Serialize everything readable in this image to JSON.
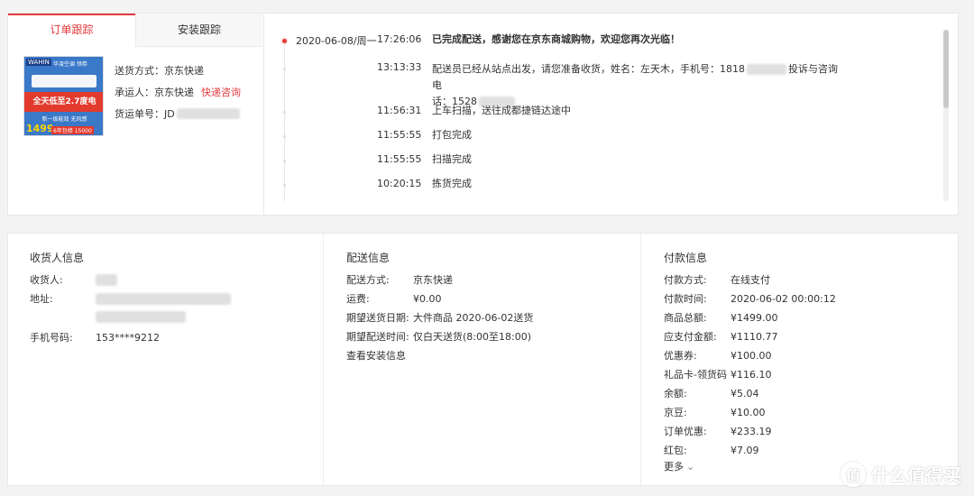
{
  "tabs": {
    "order_tracking": "订单跟踪",
    "install_tracking": "安装跟踪"
  },
  "product_image": {
    "brand": "WAHIN",
    "tag": "华凌空调 领券",
    "banner": "全天低至2.7度电",
    "sub": "新一级能效 无风感",
    "price": "1499",
    "promo": "6年包修 15000"
  },
  "shipping": {
    "method_label": "送货方式：",
    "method_value": "京东快递",
    "carrier_label": "承运人：",
    "carrier_value": "京东快递",
    "carrier_link": "快递咨询",
    "tracking_label": "货运单号：",
    "tracking_prefix": "JD"
  },
  "timeline": [
    {
      "date": "2020-06-08/周一",
      "time": "17:26:06",
      "desc": "已完成配送，感谢您在京东商城购物，欢迎您再次光临！",
      "bold": true
    },
    {
      "date": "",
      "time": "13:13:33",
      "desc_a": "配送员已经从站点出发，请您准备收货，姓名：左天木，手机号：1818",
      "desc_b": "投诉与咨询电",
      "desc_c": "话：1528"
    },
    {
      "date": "",
      "time": "11:56:31",
      "desc": "上车扫描，送往成都捷链达途中"
    },
    {
      "date": "",
      "time": "11:55:55",
      "desc": "打包完成"
    },
    {
      "date": "",
      "time": "11:55:55",
      "desc": "扫描完成"
    },
    {
      "date": "",
      "time": "10:20:15",
      "desc": "拣货完成"
    }
  ],
  "receiver": {
    "title": "收货人信息",
    "name_label": "收货人:",
    "address_label": "地址:",
    "phone_label": "手机号码:",
    "phone_value": "153****9212"
  },
  "delivery": {
    "title": "配送信息",
    "rows": [
      {
        "k": "配送方式:",
        "v": "京东快递"
      },
      {
        "k": "运费:",
        "v": "¥0.00"
      },
      {
        "k": "期望送货日期:",
        "v": "大件商品 2020-06-02送货"
      },
      {
        "k": "期望配送时间:",
        "v": "仅白天送货(8:00至18:00)"
      }
    ],
    "install_link": "查看安装信息"
  },
  "payment": {
    "title": "付款信息",
    "rows": [
      {
        "k": "付款方式:",
        "v": "在线支付"
      },
      {
        "k": "付款时间:",
        "v": "2020-06-02 00:00:12"
      },
      {
        "k": "商品总额:",
        "v": "¥1499.00"
      },
      {
        "k": "应支付金额:",
        "v": "¥1110.77"
      },
      {
        "k": "优惠券:",
        "v": "¥100.00"
      },
      {
        "k": "礼品卡-领货码",
        "v": "¥116.10"
      },
      {
        "k": "余额:",
        "v": "¥5.04"
      },
      {
        "k": "京豆:",
        "v": "¥10.00"
      },
      {
        "k": "订单优惠:",
        "v": "¥233.19"
      },
      {
        "k": "红包:",
        "v": "¥7.09"
      }
    ],
    "more_label": "更多",
    "more_icon": "⌄"
  },
  "watermark": {
    "text": "什么值得买",
    "glyph": "值"
  },
  "colors": {
    "accent": "#e4393c",
    "background": "#f3f3f3"
  }
}
